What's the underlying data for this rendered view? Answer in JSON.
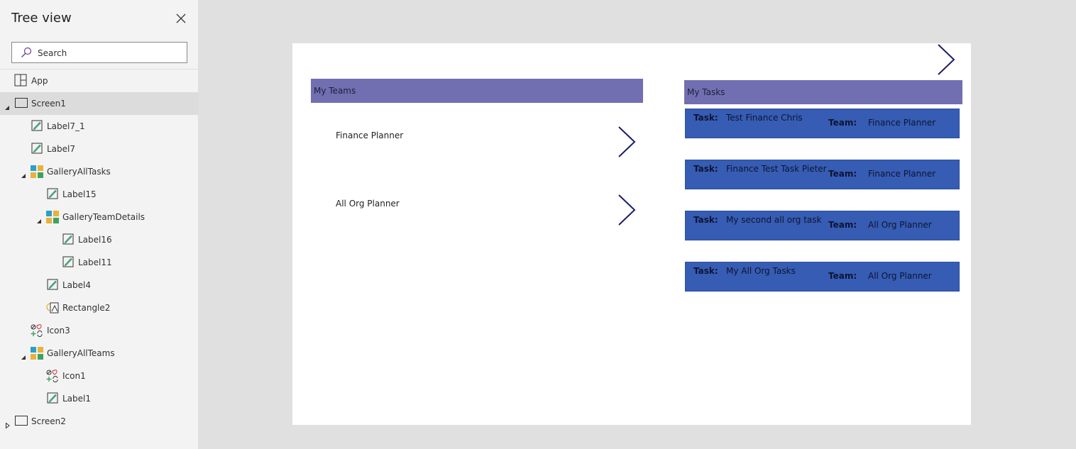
{
  "tree": {
    "title": "Tree view",
    "search_placeholder": "Search",
    "items": [
      {
        "label": "App",
        "icon": "app-icon"
      },
      {
        "label": "Screen1",
        "icon": "screen-icon"
      },
      {
        "label": "Label7_1",
        "icon": "label-icon"
      },
      {
        "label": "Label7",
        "icon": "label-icon"
      },
      {
        "label": "GalleryAllTasks",
        "icon": "gallery-icon"
      },
      {
        "label": "Label15",
        "icon": "label-icon"
      },
      {
        "label": "GalleryTeamDetails",
        "icon": "gallery-icon"
      },
      {
        "label": "Label16",
        "icon": "label-icon"
      },
      {
        "label": "Label11",
        "icon": "label-icon"
      },
      {
        "label": "Label4",
        "icon": "label-icon"
      },
      {
        "label": "Rectangle2",
        "icon": "shape-icon"
      },
      {
        "label": "Icon3",
        "icon": "icons-icon"
      },
      {
        "label": "GalleryAllTeams",
        "icon": "gallery-icon"
      },
      {
        "label": "Icon1",
        "icon": "icons-icon"
      },
      {
        "label": "Label1",
        "icon": "label-icon"
      },
      {
        "label": "Screen2",
        "icon": "screen-icon"
      }
    ]
  },
  "canvas": {
    "my_teams_header": "My Teams",
    "my_tasks_header": "My Tasks",
    "teams": [
      {
        "name": "Finance Planner"
      },
      {
        "name": "All Org Planner"
      }
    ],
    "task_key": "Task:",
    "team_key": "Team:",
    "tasks": [
      {
        "task": "Test Finance Chris",
        "team": "Finance Planner"
      },
      {
        "task": "Finance Test Task Pieter",
        "team": "Finance Planner"
      },
      {
        "task": "My second all org task",
        "team": "All Org Planner"
      },
      {
        "task": "My All Org Tasks",
        "team": "All Org Planner"
      }
    ]
  },
  "colors": {
    "header_purple": "#726eb2",
    "task_blue": "#365cb3",
    "chevron_navy": "#1b1f6b"
  }
}
